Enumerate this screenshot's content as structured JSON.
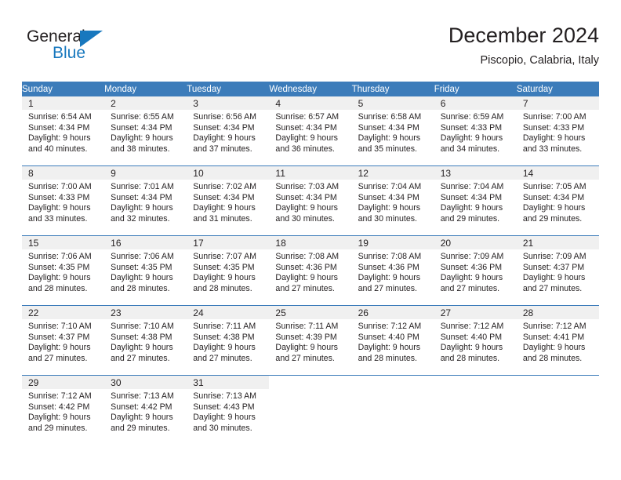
{
  "brand": {
    "name_part1": "General",
    "name_part2": "Blue",
    "triangle_color": "#1878be"
  },
  "header": {
    "title": "December 2024",
    "subtitle": "Piscopio, Calabria, Italy",
    "header_bg": "#3c7cba",
    "header_text": "#ffffff",
    "daynum_band_bg": "#f0f0f0"
  },
  "weekdays": [
    "Sunday",
    "Monday",
    "Tuesday",
    "Wednesday",
    "Thursday",
    "Friday",
    "Saturday"
  ],
  "weeks": [
    [
      {
        "day": "1",
        "sunrise": "Sunrise: 6:54 AM",
        "sunset": "Sunset: 4:34 PM",
        "daylight_line1": "Daylight: 9 hours",
        "daylight_line2": "and 40 minutes."
      },
      {
        "day": "2",
        "sunrise": "Sunrise: 6:55 AM",
        "sunset": "Sunset: 4:34 PM",
        "daylight_line1": "Daylight: 9 hours",
        "daylight_line2": "and 38 minutes."
      },
      {
        "day": "3",
        "sunrise": "Sunrise: 6:56 AM",
        "sunset": "Sunset: 4:34 PM",
        "daylight_line1": "Daylight: 9 hours",
        "daylight_line2": "and 37 minutes."
      },
      {
        "day": "4",
        "sunrise": "Sunrise: 6:57 AM",
        "sunset": "Sunset: 4:34 PM",
        "daylight_line1": "Daylight: 9 hours",
        "daylight_line2": "and 36 minutes."
      },
      {
        "day": "5",
        "sunrise": "Sunrise: 6:58 AM",
        "sunset": "Sunset: 4:34 PM",
        "daylight_line1": "Daylight: 9 hours",
        "daylight_line2": "and 35 minutes."
      },
      {
        "day": "6",
        "sunrise": "Sunrise: 6:59 AM",
        "sunset": "Sunset: 4:33 PM",
        "daylight_line1": "Daylight: 9 hours",
        "daylight_line2": "and 34 minutes."
      },
      {
        "day": "7",
        "sunrise": "Sunrise: 7:00 AM",
        "sunset": "Sunset: 4:33 PM",
        "daylight_line1": "Daylight: 9 hours",
        "daylight_line2": "and 33 minutes."
      }
    ],
    [
      {
        "day": "8",
        "sunrise": "Sunrise: 7:00 AM",
        "sunset": "Sunset: 4:33 PM",
        "daylight_line1": "Daylight: 9 hours",
        "daylight_line2": "and 33 minutes."
      },
      {
        "day": "9",
        "sunrise": "Sunrise: 7:01 AM",
        "sunset": "Sunset: 4:34 PM",
        "daylight_line1": "Daylight: 9 hours",
        "daylight_line2": "and 32 minutes."
      },
      {
        "day": "10",
        "sunrise": "Sunrise: 7:02 AM",
        "sunset": "Sunset: 4:34 PM",
        "daylight_line1": "Daylight: 9 hours",
        "daylight_line2": "and 31 minutes."
      },
      {
        "day": "11",
        "sunrise": "Sunrise: 7:03 AM",
        "sunset": "Sunset: 4:34 PM",
        "daylight_line1": "Daylight: 9 hours",
        "daylight_line2": "and 30 minutes."
      },
      {
        "day": "12",
        "sunrise": "Sunrise: 7:04 AM",
        "sunset": "Sunset: 4:34 PM",
        "daylight_line1": "Daylight: 9 hours",
        "daylight_line2": "and 30 minutes."
      },
      {
        "day": "13",
        "sunrise": "Sunrise: 7:04 AM",
        "sunset": "Sunset: 4:34 PM",
        "daylight_line1": "Daylight: 9 hours",
        "daylight_line2": "and 29 minutes."
      },
      {
        "day": "14",
        "sunrise": "Sunrise: 7:05 AM",
        "sunset": "Sunset: 4:34 PM",
        "daylight_line1": "Daylight: 9 hours",
        "daylight_line2": "and 29 minutes."
      }
    ],
    [
      {
        "day": "15",
        "sunrise": "Sunrise: 7:06 AM",
        "sunset": "Sunset: 4:35 PM",
        "daylight_line1": "Daylight: 9 hours",
        "daylight_line2": "and 28 minutes."
      },
      {
        "day": "16",
        "sunrise": "Sunrise: 7:06 AM",
        "sunset": "Sunset: 4:35 PM",
        "daylight_line1": "Daylight: 9 hours",
        "daylight_line2": "and 28 minutes."
      },
      {
        "day": "17",
        "sunrise": "Sunrise: 7:07 AM",
        "sunset": "Sunset: 4:35 PM",
        "daylight_line1": "Daylight: 9 hours",
        "daylight_line2": "and 28 minutes."
      },
      {
        "day": "18",
        "sunrise": "Sunrise: 7:08 AM",
        "sunset": "Sunset: 4:36 PM",
        "daylight_line1": "Daylight: 9 hours",
        "daylight_line2": "and 27 minutes."
      },
      {
        "day": "19",
        "sunrise": "Sunrise: 7:08 AM",
        "sunset": "Sunset: 4:36 PM",
        "daylight_line1": "Daylight: 9 hours",
        "daylight_line2": "and 27 minutes."
      },
      {
        "day": "20",
        "sunrise": "Sunrise: 7:09 AM",
        "sunset": "Sunset: 4:36 PM",
        "daylight_line1": "Daylight: 9 hours",
        "daylight_line2": "and 27 minutes."
      },
      {
        "day": "21",
        "sunrise": "Sunrise: 7:09 AM",
        "sunset": "Sunset: 4:37 PM",
        "daylight_line1": "Daylight: 9 hours",
        "daylight_line2": "and 27 minutes."
      }
    ],
    [
      {
        "day": "22",
        "sunrise": "Sunrise: 7:10 AM",
        "sunset": "Sunset: 4:37 PM",
        "daylight_line1": "Daylight: 9 hours",
        "daylight_line2": "and 27 minutes."
      },
      {
        "day": "23",
        "sunrise": "Sunrise: 7:10 AM",
        "sunset": "Sunset: 4:38 PM",
        "daylight_line1": "Daylight: 9 hours",
        "daylight_line2": "and 27 minutes."
      },
      {
        "day": "24",
        "sunrise": "Sunrise: 7:11 AM",
        "sunset": "Sunset: 4:38 PM",
        "daylight_line1": "Daylight: 9 hours",
        "daylight_line2": "and 27 minutes."
      },
      {
        "day": "25",
        "sunrise": "Sunrise: 7:11 AM",
        "sunset": "Sunset: 4:39 PM",
        "daylight_line1": "Daylight: 9 hours",
        "daylight_line2": "and 27 minutes."
      },
      {
        "day": "26",
        "sunrise": "Sunrise: 7:12 AM",
        "sunset": "Sunset: 4:40 PM",
        "daylight_line1": "Daylight: 9 hours",
        "daylight_line2": "and 28 minutes."
      },
      {
        "day": "27",
        "sunrise": "Sunrise: 7:12 AM",
        "sunset": "Sunset: 4:40 PM",
        "daylight_line1": "Daylight: 9 hours",
        "daylight_line2": "and 28 minutes."
      },
      {
        "day": "28",
        "sunrise": "Sunrise: 7:12 AM",
        "sunset": "Sunset: 4:41 PM",
        "daylight_line1": "Daylight: 9 hours",
        "daylight_line2": "and 28 minutes."
      }
    ],
    [
      {
        "day": "29",
        "sunrise": "Sunrise: 7:12 AM",
        "sunset": "Sunset: 4:42 PM",
        "daylight_line1": "Daylight: 9 hours",
        "daylight_line2": "and 29 minutes."
      },
      {
        "day": "30",
        "sunrise": "Sunrise: 7:13 AM",
        "sunset": "Sunset: 4:42 PM",
        "daylight_line1": "Daylight: 9 hours",
        "daylight_line2": "and 29 minutes."
      },
      {
        "day": "31",
        "sunrise": "Sunrise: 7:13 AM",
        "sunset": "Sunset: 4:43 PM",
        "daylight_line1": "Daylight: 9 hours",
        "daylight_line2": "and 30 minutes."
      },
      {
        "day": "",
        "sunrise": "",
        "sunset": "",
        "daylight_line1": "",
        "daylight_line2": ""
      },
      {
        "day": "",
        "sunrise": "",
        "sunset": "",
        "daylight_line1": "",
        "daylight_line2": ""
      },
      {
        "day": "",
        "sunrise": "",
        "sunset": "",
        "daylight_line1": "",
        "daylight_line2": ""
      },
      {
        "day": "",
        "sunrise": "",
        "sunset": "",
        "daylight_line1": "",
        "daylight_line2": ""
      }
    ]
  ]
}
